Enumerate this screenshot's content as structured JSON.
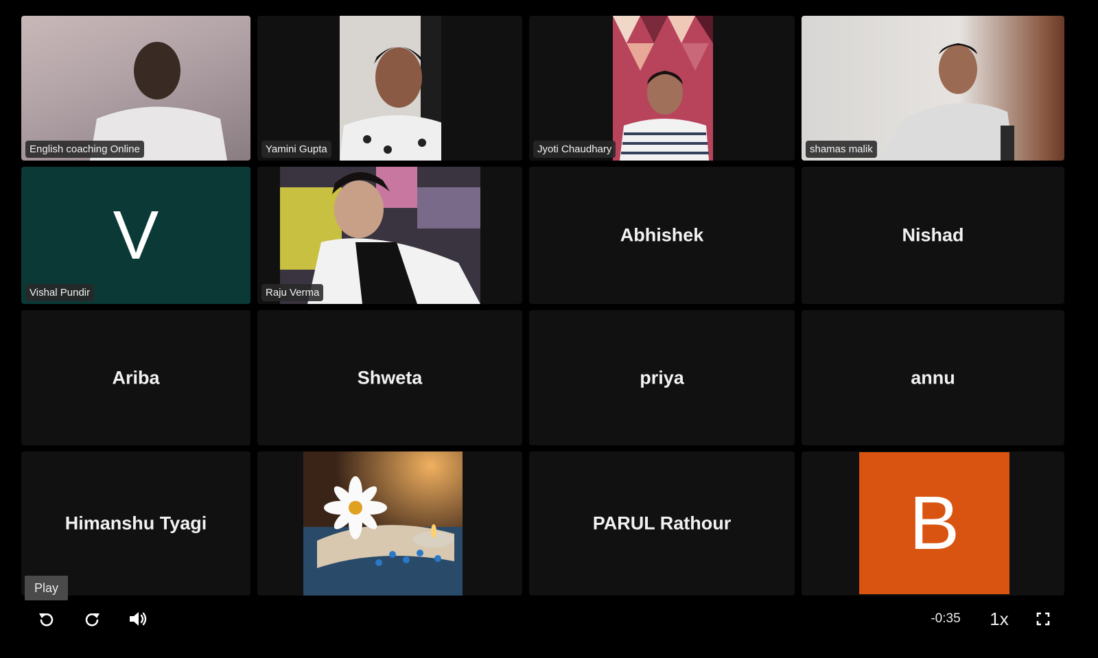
{
  "participants": [
    {
      "name": "English coaching Online"
    },
    {
      "name": "Yamini Gupta"
    },
    {
      "name": "Jyoti Chaudhary"
    },
    {
      "name": "shamas malik"
    },
    {
      "name": "Vishal Pundir",
      "avatar_letter": "V",
      "avatar_color": "#0b3a36"
    },
    {
      "name": "Raju Verma"
    },
    {
      "name": "Abhishek"
    },
    {
      "name": "Nishad"
    },
    {
      "name": "Ariba"
    },
    {
      "name": "Shweta"
    },
    {
      "name": "priya"
    },
    {
      "name": "annu"
    },
    {
      "name": "Himanshu Tyagi"
    },
    {
      "image": "flower-candle-image"
    },
    {
      "name": "PARUL Rathour"
    },
    {
      "avatar_letter": "B",
      "avatar_color": "#d95410"
    }
  ],
  "player": {
    "tooltip": "Play",
    "time_remaining": "-0:35",
    "speed": "1x",
    "icons": {
      "rewind": "rewind-icon",
      "forward": "forward-icon",
      "volume": "volume-icon",
      "fullscreen": "fullscreen-icon"
    }
  }
}
